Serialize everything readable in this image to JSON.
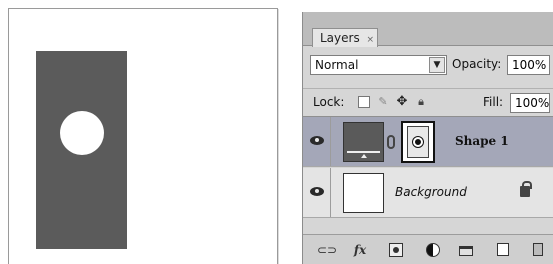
{
  "canvas": {
    "shape_fill": "#5b5b5b",
    "circle_fill": "#ffffff"
  },
  "layers_panel": {
    "tab_label": "Layers",
    "tab_close": "×",
    "blend_mode": "Normal",
    "opacity_label": "Opacity:",
    "opacity_value": "100%",
    "lock_label": "Lock:",
    "lock_icons": [
      "lock-transparent-icon",
      "lock-paint-icon",
      "lock-move-icon",
      "lock-all-icon"
    ],
    "fill_label": "Fill:",
    "fill_value": "100%",
    "layers": [
      {
        "name": "Shape 1",
        "selected": true,
        "visible": true
      },
      {
        "name": "Background",
        "selected": false,
        "visible": true,
        "locked": true
      }
    ],
    "footer_icons": [
      "link-layers-icon",
      "fx-icon",
      "add-mask-icon",
      "adjustment-layer-icon",
      "new-group-icon",
      "new-layer-icon",
      "trash-icon"
    ],
    "footer_fx_label": "fx",
    "selected_color": "#a4a7b8"
  }
}
